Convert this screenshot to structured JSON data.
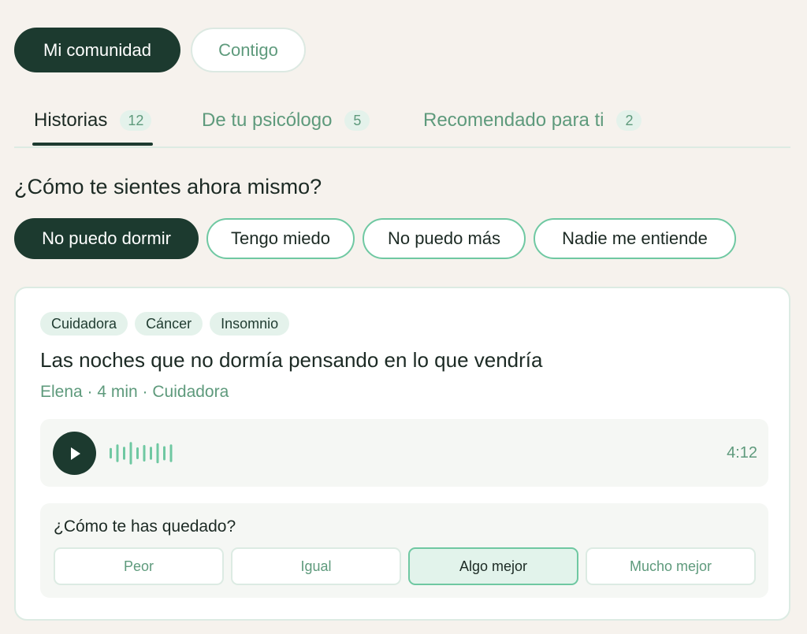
{
  "segment": {
    "active_label": "Mi comunidad",
    "inactive_label": "Contigo"
  },
  "tabs": [
    {
      "label": "Historias",
      "count": "12",
      "active": true
    },
    {
      "label": "De tu psicólogo",
      "count": "5",
      "active": false
    },
    {
      "label": "Recomendado para ti",
      "count": "2",
      "active": false
    }
  ],
  "mood": {
    "question": "¿Cómo te sientes ahora mismo?",
    "options": [
      "No puedo dormir",
      "Tengo miedo",
      "No puedo más",
      "Nadie me entiende"
    ],
    "selected": "No puedo dormir"
  },
  "story": {
    "tags": [
      "Cuidadora",
      "Cáncer",
      "Insomnio"
    ],
    "title": "Las noches que no dormía pensando en lo que vendría",
    "meta": "Elena · 4 min · Cuidadora",
    "audio": {
      "duration": "4:12",
      "play_icon": "play-icon",
      "waveform_levels": [
        0.45,
        0.75,
        0.55,
        0.95,
        0.5,
        0.7,
        0.55,
        0.85,
        0.6,
        0.75
      ]
    }
  },
  "feedback": {
    "question": "¿Cómo te has quedado?",
    "options": [
      "Peor",
      "Igual",
      "Algo mejor",
      "Mucho mejor"
    ],
    "selected": "Algo mejor"
  },
  "colors": {
    "background": "#f6f2ed",
    "dark_green": "#1c3a2f",
    "muted_green": "#5e9a7c",
    "accent_mint": "#6fc8a2",
    "chip_bg": "#e4f2eb"
  }
}
